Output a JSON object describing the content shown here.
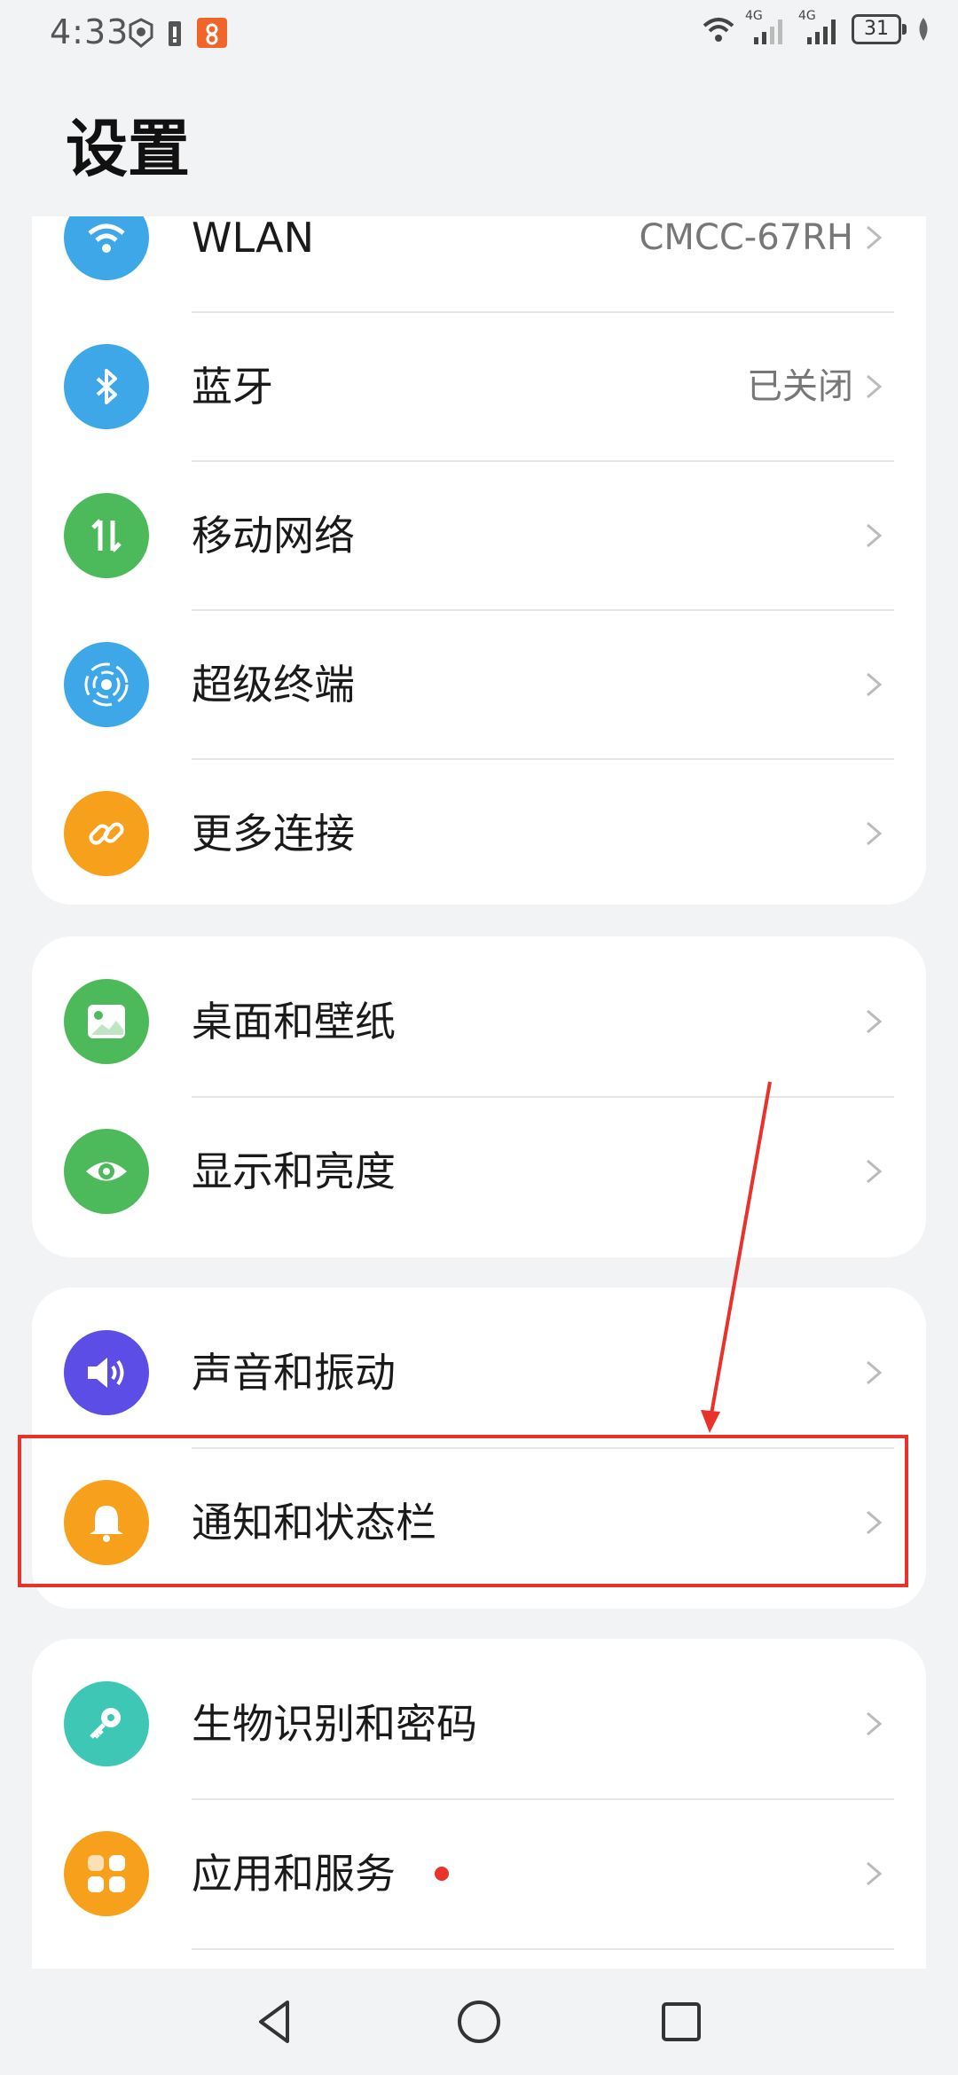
{
  "status_bar": {
    "time": "4:33",
    "network_1": "4G",
    "network_2": "4G",
    "battery": "31",
    "icons": [
      "hand-icon",
      "battery-alert-icon",
      "app-notification-icon",
      "wifi-icon",
      "signal-icon",
      "signal-icon",
      "battery-icon",
      "leaf-icon"
    ]
  },
  "page_title": "设置",
  "sections": [
    {
      "items": [
        {
          "label": "WLAN",
          "value": "CMCC-67RH",
          "icon": "wifi-icon",
          "color": "#3ea7e8"
        },
        {
          "label": "蓝牙",
          "value": "已关闭",
          "icon": "bluetooth-icon",
          "color": "#3ea7e8"
        },
        {
          "label": "移动网络",
          "value": "",
          "icon": "mobile-data-icon",
          "color": "#4cba5a"
        },
        {
          "label": "超级终端",
          "value": "",
          "icon": "super-device-icon",
          "color": "#3ea7e8"
        },
        {
          "label": "更多连接",
          "value": "",
          "icon": "link-icon",
          "color": "#f7a01c"
        }
      ]
    },
    {
      "items": [
        {
          "label": "桌面和壁纸",
          "value": "",
          "icon": "wallpaper-icon",
          "color": "#4cba5a"
        },
        {
          "label": "显示和亮度",
          "value": "",
          "icon": "eye-icon",
          "color": "#4cba5a"
        }
      ]
    },
    {
      "items": [
        {
          "label": "声音和振动",
          "value": "",
          "icon": "speaker-icon",
          "color": "#5b4de6"
        },
        {
          "label": "通知和状态栏",
          "value": "",
          "icon": "bell-icon",
          "color": "#f7a01c"
        }
      ]
    },
    {
      "items": [
        {
          "label": "生物识别和密码",
          "value": "",
          "icon": "key-icon",
          "color": "#3ec7b4"
        },
        {
          "label": "应用和服务",
          "value": "",
          "icon": "apps-icon",
          "color": "#f7a01c",
          "badge": "red-dot"
        }
      ]
    }
  ],
  "annotation": {
    "color": "#e8322a",
    "target": "通知和状态栏"
  },
  "nav_bar": {
    "buttons": [
      "back-icon",
      "home-icon",
      "recents-icon"
    ]
  }
}
